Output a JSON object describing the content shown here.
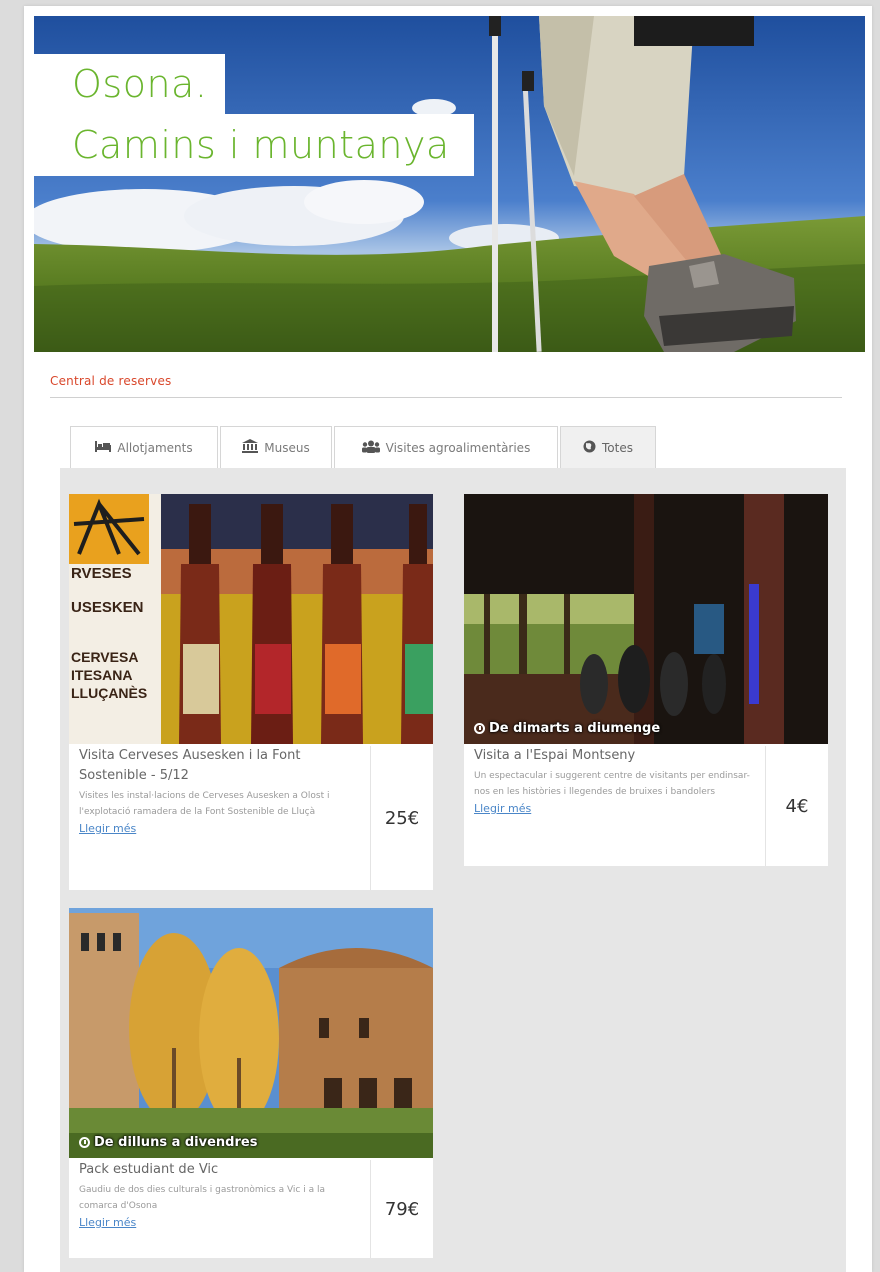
{
  "hero": {
    "title_line1": "Osona.",
    "title_line2": "Camins i muntanya"
  },
  "section_heading": "Central de reserves",
  "tabs": [
    {
      "icon": "bed-icon",
      "label": "Allotjaments",
      "active": false
    },
    {
      "icon": "museum-icon",
      "label": "Museus",
      "active": false
    },
    {
      "icon": "group-icon",
      "label": "Visites agroalimentàries",
      "active": false
    },
    {
      "icon": "globe-icon",
      "label": "Totes",
      "active": true
    }
  ],
  "cards": [
    {
      "title": "Visita Cerveses Ausesken i la Font Sostenible - 5/12",
      "description": "Visites les instal·lacions de Cerveses Ausesken a Olost i l'explotació ramadera de la Font Sostenible de Lluçà",
      "more": "Llegir més",
      "price": "25€",
      "badge": "",
      "image_texts": [
        "RVESES",
        "USESKEN",
        "CERVESA",
        "ITESANA",
        "LLUÇANÈS"
      ]
    },
    {
      "title": "Visita a l'Espai Montseny",
      "description": "Un espectacular i suggerent centre de visitants per endinsar-nos en les històries i llegendes de bruixes i bandolers",
      "more": "Llegir més",
      "price": "4€",
      "badge": "De dimarts a diumenge"
    },
    {
      "title": "Pack estudiant de Vic",
      "description": "Gaudiu de dos dies culturals i gastronòmics a Vic i a la comarca d'Osona",
      "more": "Llegir més",
      "price": "79€",
      "badge": "De dilluns a divendres"
    }
  ],
  "colors": {
    "accent_green": "#6ab52e",
    "heading_red": "#d9472b",
    "link_blue": "#4a86c8",
    "panel_gray": "#e6e6e6"
  }
}
